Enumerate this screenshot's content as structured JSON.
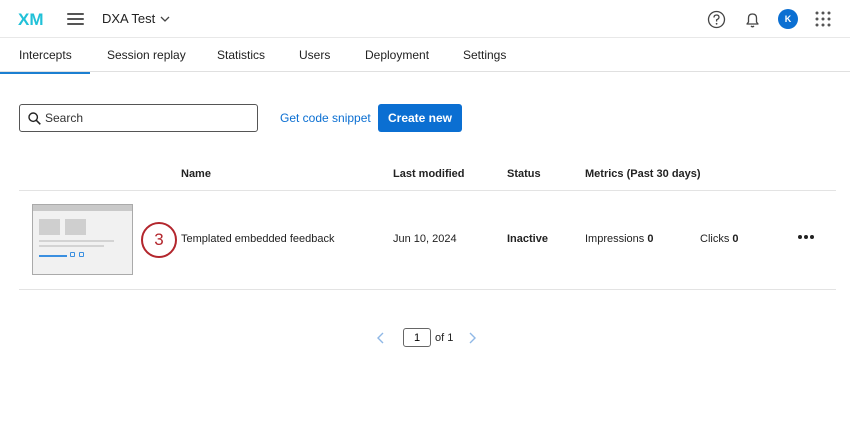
{
  "header": {
    "logo": "XM",
    "project_name": "DXA Test",
    "avatar_initial": "K"
  },
  "tabs": [
    {
      "label": "Intercepts",
      "active": true
    },
    {
      "label": "Session replay",
      "active": false
    },
    {
      "label": "Statistics",
      "active": false
    },
    {
      "label": "Users",
      "active": false
    },
    {
      "label": "Deployment",
      "active": false
    },
    {
      "label": "Settings",
      "active": false
    }
  ],
  "toolbar": {
    "search_placeholder": "Search",
    "snippet_label": "Get code snippet",
    "create_label": "Create new"
  },
  "table": {
    "columns": {
      "name": "Name",
      "last_modified": "Last modified",
      "status": "Status",
      "metrics": "Metrics (Past 30 days)"
    },
    "rows": [
      {
        "badge": "3",
        "name": "Templated embedded feedback",
        "last_modified": "Jun 10, 2024",
        "status": "Inactive",
        "impressions_label": "Impressions",
        "impressions": "0",
        "clicks_label": "Clicks",
        "clicks": "0"
      }
    ]
  },
  "pagination": {
    "page": "1",
    "of_label": "of 1"
  },
  "colors": {
    "accent": "#0b6fd2",
    "badge": "#b3262d",
    "logo_cyan": "#21c1d8"
  }
}
